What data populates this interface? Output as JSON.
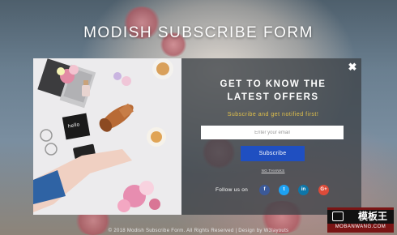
{
  "page": {
    "title": "MODISH SUBSCRIBE FORM"
  },
  "modal": {
    "close_glyph": "✖",
    "heading_line1": "GET TO KNOW THE",
    "heading_line2": "LATEST OFFERS",
    "subheading": "Subscribe and get notified first!",
    "email_placeholder": "Enter your email",
    "email_value": "",
    "subscribe_label": "Subscribe",
    "no_thanks_label": "NO THANKS",
    "follow_label": "Follow us on",
    "social": [
      {
        "name": "facebook-icon",
        "glyph": "f",
        "color": "#3b5998"
      },
      {
        "name": "twitter-icon",
        "glyph": "t",
        "color": "#1da1f2"
      },
      {
        "name": "linkedin-icon",
        "glyph": "in",
        "color": "#0e76a8"
      },
      {
        "name": "google-plus-icon",
        "glyph": "G+",
        "color": "#dd4b39"
      }
    ]
  },
  "footer": {
    "text": "© 2018 Modish Subscribe Form. All Rights Reserved | Design by W3layouts"
  },
  "watermark": {
    "brand": "模板王",
    "url": "MOBANWANG.COM"
  },
  "colors": {
    "accent_button": "#1f4fc1",
    "subheading": "#e2c14b",
    "overlay": "#3e4348"
  }
}
